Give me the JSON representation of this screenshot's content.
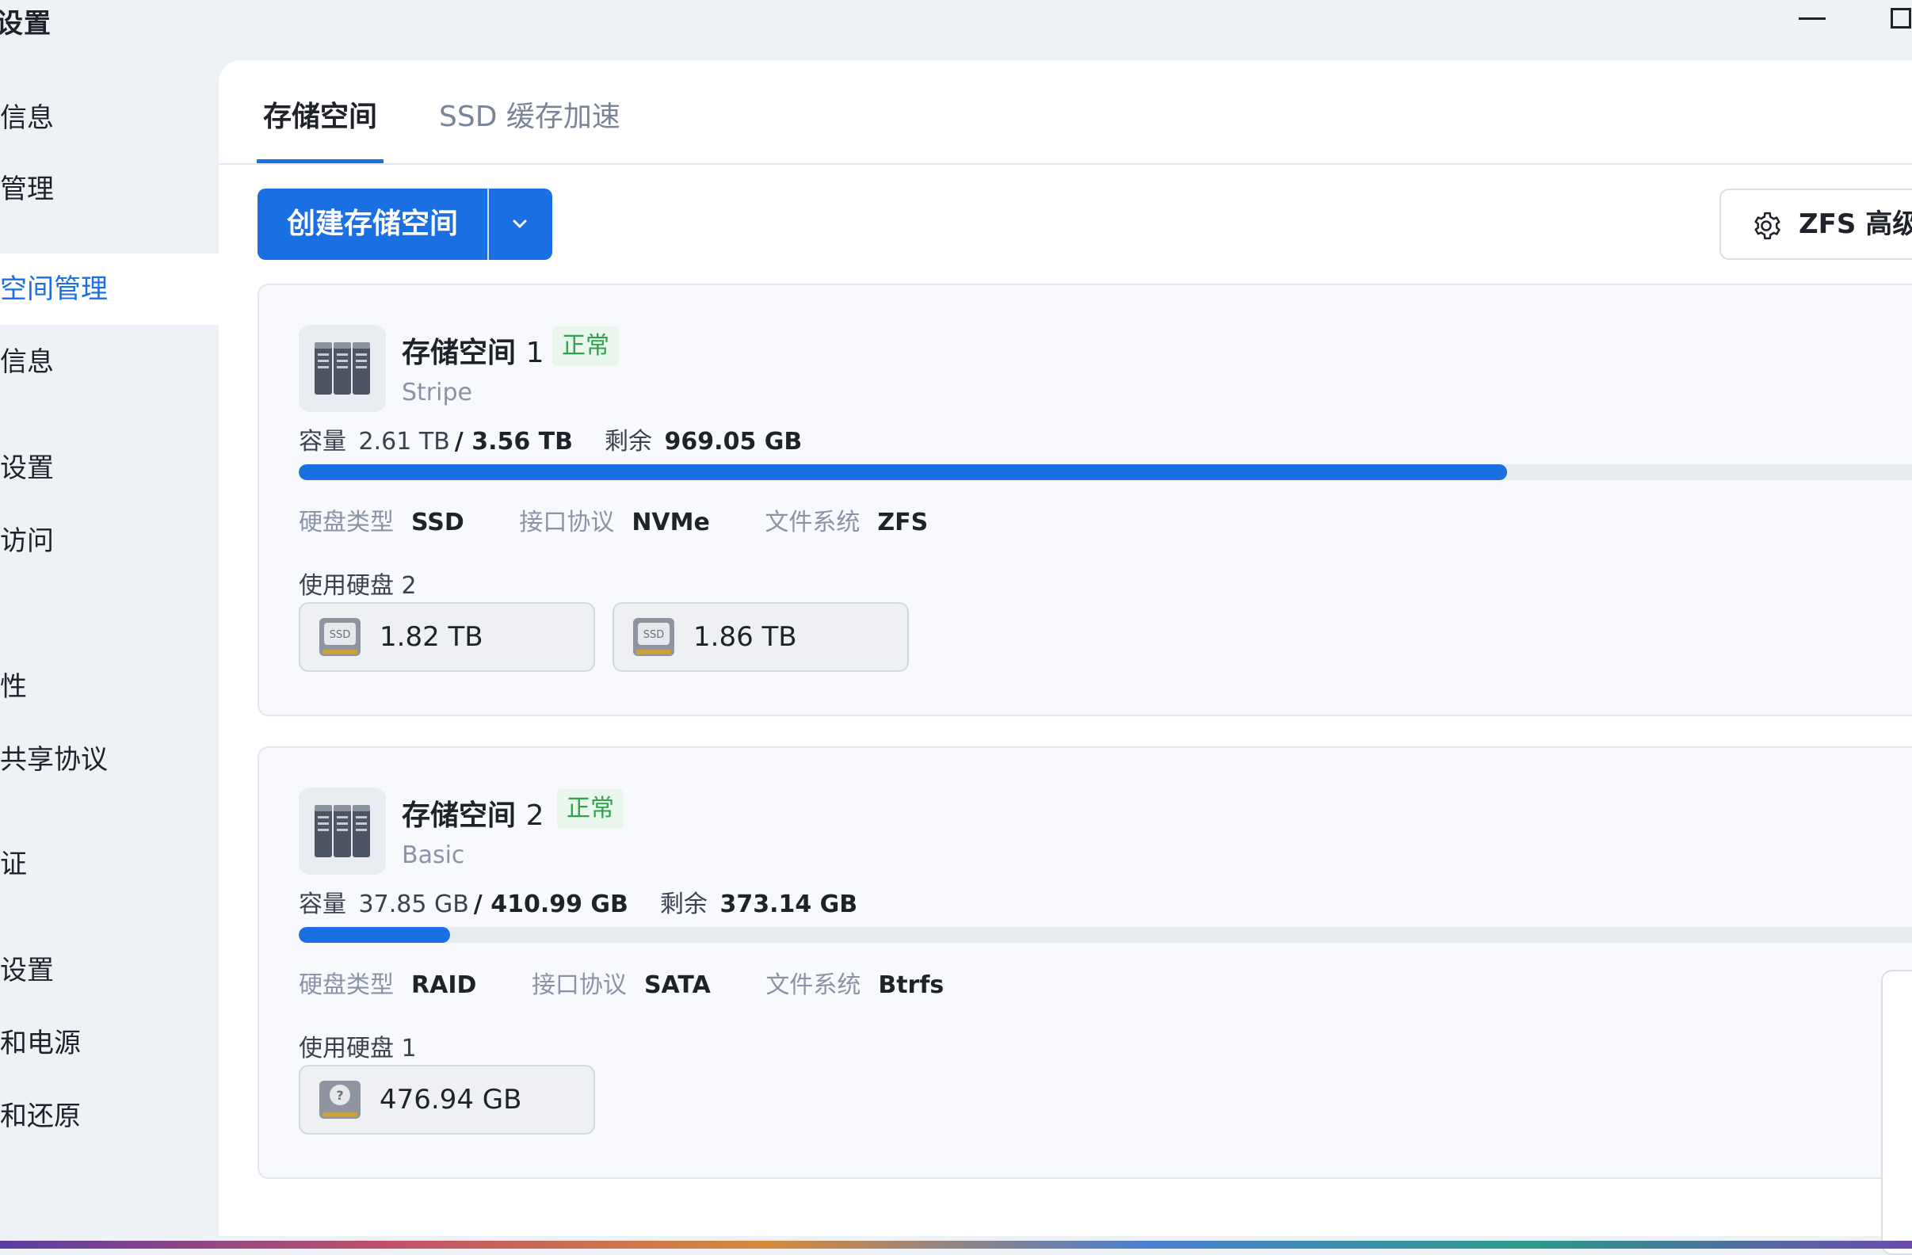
{
  "window": {
    "title": "统设置"
  },
  "sidebar": {
    "items": [
      {
        "label": "信息"
      },
      {
        "label": "管理"
      },
      {
        "label": "空间管理"
      },
      {
        "label": "信息"
      },
      {
        "label": "设置"
      },
      {
        "label": "访问"
      },
      {
        "label": "性"
      },
      {
        "label": "共享协议"
      },
      {
        "label": "证"
      },
      {
        "label": "设置"
      },
      {
        "label": "和电源"
      },
      {
        "label": "和还原"
      }
    ],
    "active_index": 2
  },
  "tabs": [
    {
      "label": "存储空间"
    },
    {
      "label": "SSD 缓存加速"
    }
  ],
  "toolbar": {
    "create_label": "创建存储空间",
    "zfs_label": "ZFS 高级设"
  },
  "pools": [
    {
      "name": "存储空间",
      "number": "1",
      "status": "正常",
      "type": "Stripe",
      "capacity_label": "容量",
      "used": "2.61 TB",
      "total": "/ 3.56 TB",
      "free_label": "剩余",
      "free": "969.05 GB",
      "usage_fraction": 0.733,
      "disk_type_label": "硬盘类型",
      "disk_type": "SSD",
      "interface_label": "接口协议",
      "interface": "NVMe",
      "fs_label": "文件系统",
      "fs": "ZFS",
      "disks_label": "使用硬盘 2",
      "disks": [
        {
          "icon": "ssd-icon",
          "size": "1.82 TB"
        },
        {
          "icon": "ssd-icon",
          "size": "1.86 TB"
        }
      ]
    },
    {
      "name": "存储空间",
      "number": "2",
      "status": "正常",
      "type": "Basic",
      "capacity_label": "容量",
      "used": "37.85 GB",
      "total": "/ 410.99 GB",
      "free_label": "剩余",
      "free": "373.14 GB",
      "usage_fraction": 0.092,
      "disk_type_label": "硬盘类型",
      "disk_type": "RAID",
      "interface_label": "接口协议",
      "interface": "SATA",
      "fs_label": "文件系统",
      "fs": "Btrfs",
      "disks_label": "使用硬盘 1",
      "disks": [
        {
          "icon": "unknown-disk-icon",
          "size": "476.94 GB"
        }
      ]
    }
  ],
  "colors": {
    "accent": "#1a6fe3",
    "status_ok": "#2fa24d",
    "status_ok_bg": "#e8f6ec"
  }
}
